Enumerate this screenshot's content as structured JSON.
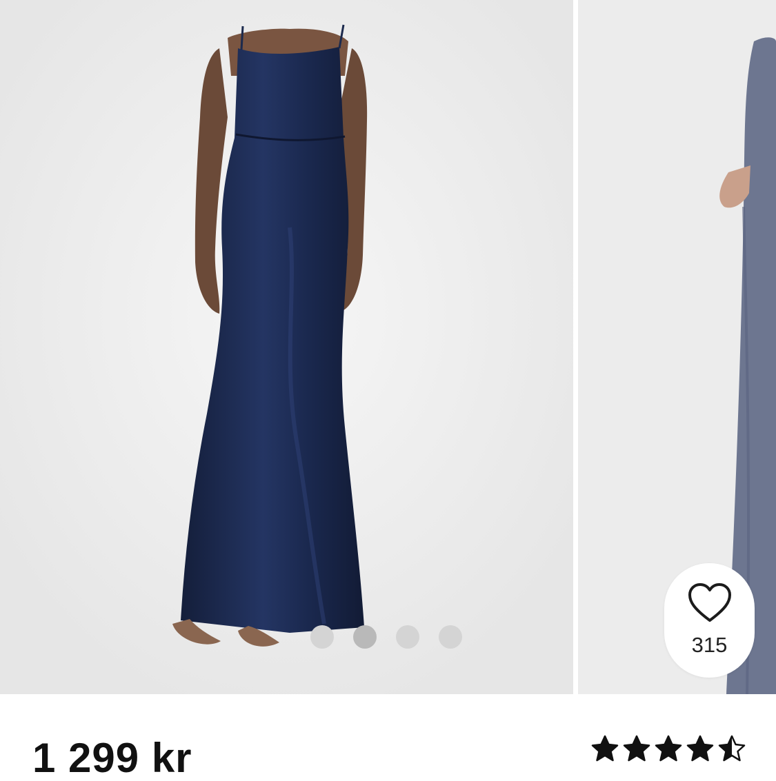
{
  "product": {
    "price": "1 299 kr",
    "favorites_count": "315",
    "rating_value": 4.5,
    "rating_max": 5,
    "dress_color": "#1c2a4d",
    "alt_dress_color": "#6d7690"
  },
  "gallery": {
    "slide_count": 4,
    "active_slide": 2
  },
  "icons": {
    "favorite": "heart-outline-icon",
    "rating": "star-icon"
  }
}
